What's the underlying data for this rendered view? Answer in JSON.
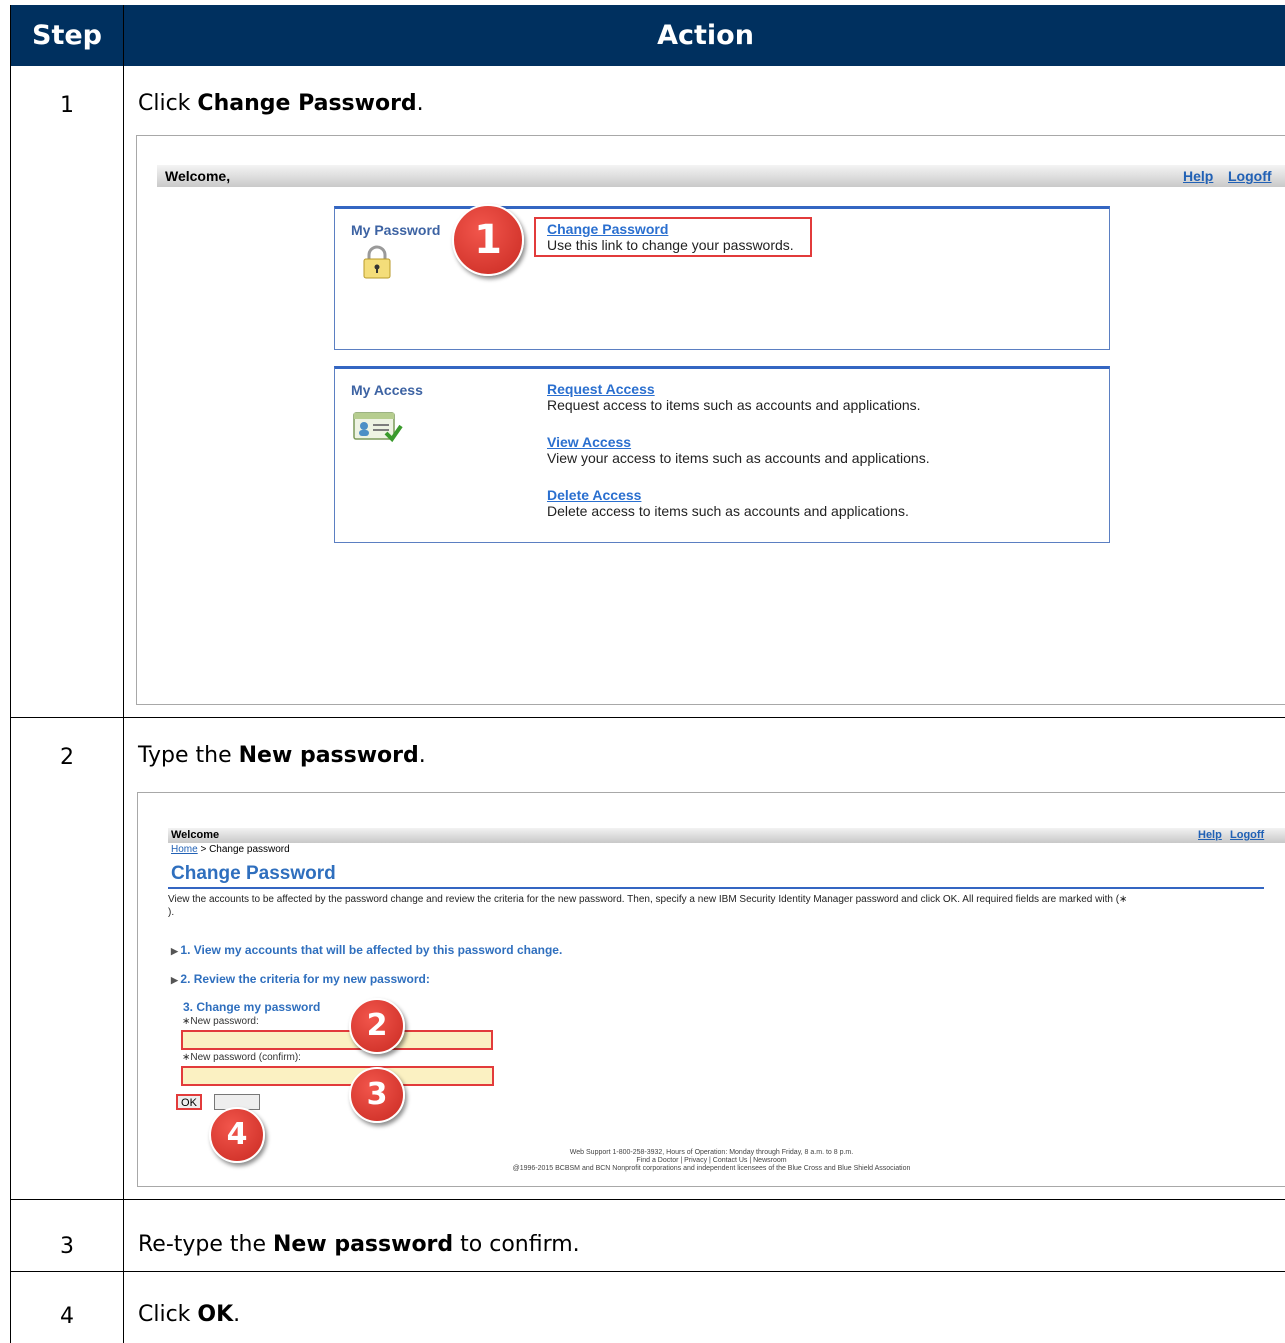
{
  "header": {
    "step": "Step",
    "action": "Action"
  },
  "steps": [
    {
      "num": "1",
      "pre": "Click ",
      "bold": "Change Password",
      "post": "."
    },
    {
      "num": "2",
      "pre": "Type the ",
      "bold": "New password",
      "post": "."
    },
    {
      "num": "3",
      "pre": "Re-type the ",
      "bold": "New password",
      "post": " to confirm."
    },
    {
      "num": "4",
      "pre": "Click ",
      "bold": "OK",
      "post": "."
    }
  ],
  "shot1": {
    "welcome": "Welcome,",
    "help": "Help",
    "logoff": "Logoff",
    "password_panel": {
      "title": "My Password",
      "link": "Change Password",
      "desc": "Use this link to change your passwords."
    },
    "access_panel": {
      "title": "My Access",
      "items": [
        {
          "link": "Request Access",
          "desc": "Request access to items such as accounts and applications."
        },
        {
          "link": "View Access",
          "desc": "View your access to items such as accounts and applications."
        },
        {
          "link": "Delete Access",
          "desc": "Delete access to items such as accounts and applications."
        }
      ]
    },
    "badge": "1"
  },
  "shot2": {
    "welcome": "Welcome",
    "help": "Help",
    "logoff": "Logoff",
    "breadcrumb_home": "Home",
    "breadcrumb_rest": " > Change password",
    "title": "Change Password",
    "intro_line1": "View the accounts to be affected by the password change and review the criteria for the new password. Then, specify a new IBM Security Identity Manager password and click OK. All required fields are marked with (∗",
    "intro_line2": ").",
    "section1": "1. View my accounts that will be affected by this password change.",
    "section2": "2. Review the criteria for my new password:",
    "section3": "3. Change my password",
    "new_password_label": "∗New password:",
    "confirm_label": "∗New password (confirm):",
    "ok": "OK",
    "badges": [
      "2",
      "3",
      "4"
    ],
    "footer_line1": "Web Support 1-800-258-3932, Hours of Operation: Monday through Friday, 8 a.m. to 8 p.m.",
    "footer_line2": "Find a Doctor | Privacy | Contact Us | Newsroom",
    "footer_line3": "@1996-2015 BCBSM and BCN Nonprofit corporations and independent licensees of the Blue Cross and Blue Shield Association"
  },
  "colors": {
    "header_bg": "#00305f",
    "link": "#2a6fcf",
    "highlight": "#e23b3b",
    "badge": "#d9342b"
  }
}
